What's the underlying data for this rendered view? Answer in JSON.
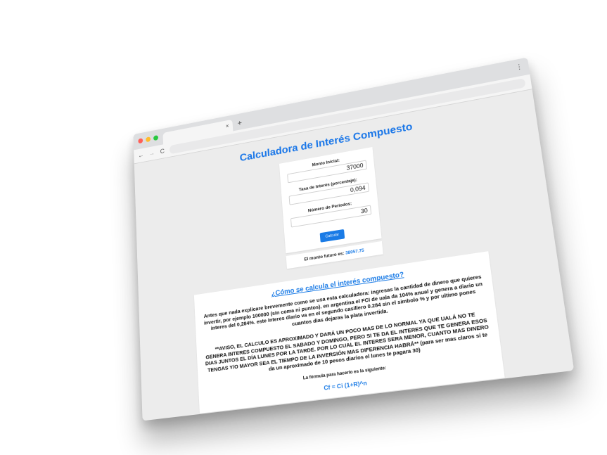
{
  "browser": {
    "tab_close": "×",
    "new_tab": "+",
    "back": "←",
    "forward": "→",
    "reload": "C",
    "menu": "⋮",
    "traffic_lights": [
      "#ff5f57",
      "#febc2e",
      "#28c840"
    ]
  },
  "page": {
    "title": "Calculadora de Interés Compuesto",
    "form": {
      "initial_label": "Monto Inicial:",
      "initial_value": "37000",
      "rate_label": "Tasa de Interés (porcentaje):",
      "rate_value": "0,094",
      "periods_label": "Número de Periodos:",
      "periods_value": "30",
      "button_label": "Calcular"
    },
    "result": {
      "label": "El monto futuro es:",
      "value": "38057.75"
    },
    "info": {
      "title": "¿Cómo se calcula el interés compuesto?",
      "intro": "Antes que nada explicare brevemente como se usa esta calculadora: ingresas la cantidad de dinero que quieres invertir, por ejemplo 100000 (sin coma ni puntos). en argentina el FCI de uala da 104% anual y genera a diario un interes del 0,284%. este interes diario va en el segundo casillero 0.284 sin el simbolo % y por ultimo pones cuantos dias dejaras la plata invertida.",
      "warning_caps": "**AVISO, EL CALCULO ES APROXIMADO Y DARÁ UN POCO MAS DE LO NORMAL YA QUE UALÁ NO TE GENERA INTERES COMPUESTO EL SABADO Y DOMINGO, PERO SI TE DA EL INTERES QUE TE GENERA ESOS DIAS JUNTOS EL DÍA LUNES POR LA TARDE. POR LO CUAL EL INTERES SERA MENOR, CUANTO MAS DINERO TENGAS Y/O MAYOR SEA EL TIEMPO DE LA INVERSIÓN MAS DIFERENCIA HABRÁ**",
      "warning_tail": " (para ser mas claros si te da un aproximado de 10 pesos diarios el lunes te pagara 30)",
      "formula_label": "La fórmula para hacerlo es la siguiente:",
      "formula": "Cf = Ci (1+R)^n"
    }
  },
  "colors": {
    "accent": "#1a7be6",
    "page_background": "#ececec",
    "card_background": "#ffffff"
  }
}
